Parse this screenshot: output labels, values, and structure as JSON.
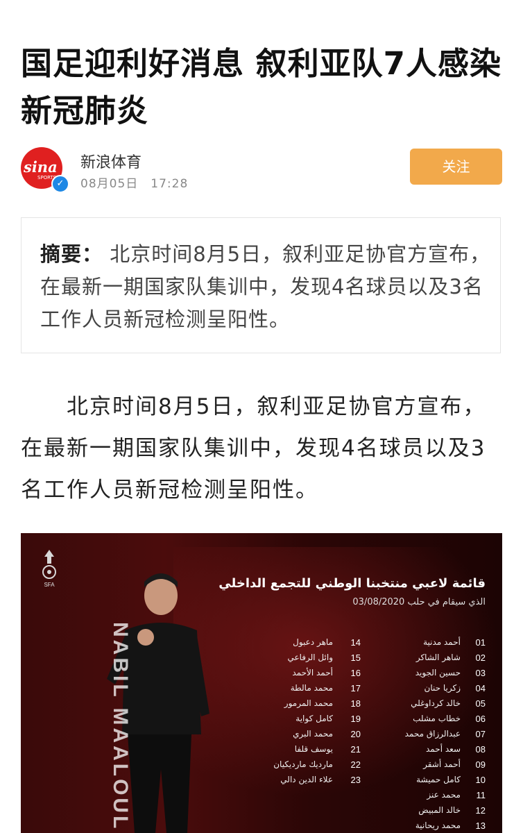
{
  "article": {
    "headline": "国足迎利好消息 叙利亚队7人感染新冠肺炎",
    "author": {
      "name": "新浪体育",
      "avatar_text": "sina",
      "avatar_sub": "SPORTS",
      "time": "08月05日　17:28"
    },
    "follow_label": "关注",
    "summary_label": "摘要：",
    "summary_text": "北京时间8月5日，叙利亚足协官方宣布，在最新一期国家队集训中，发现4名球员以及3名工作人员新冠检测呈阳性。",
    "body": "北京时间8月5日，叙利亚足协官方宣布，在最新一期国家队集训中，发现4名球员以及3名工作人员新冠检测呈阳性。"
  },
  "photo": {
    "emblem_text": "SFA",
    "vertical_name": "NABIL MAALOUL",
    "title_ar": "قائمة لاعبي منتخبنا الوطني للتجمع الداخلي",
    "subtitle_ar": "الذي سيقام في حلب 03/08/2020",
    "players_left": [
      {
        "num": "01",
        "name": "أحمد مدنية"
      },
      {
        "num": "02",
        "name": "شاهر الشاكر"
      },
      {
        "num": "03",
        "name": "حسين الجويد"
      },
      {
        "num": "04",
        "name": "زكريا حنان"
      },
      {
        "num": "05",
        "name": "خالد كرداوغلي"
      },
      {
        "num": "06",
        "name": "خطاب مشلب"
      },
      {
        "num": "07",
        "name": "عبدالرزاق محمد"
      },
      {
        "num": "08",
        "name": "سعد أحمد"
      },
      {
        "num": "09",
        "name": "أحمد أشقر"
      },
      {
        "num": "10",
        "name": "كامل حميشة"
      },
      {
        "num": "11",
        "name": "محمد عنز"
      },
      {
        "num": "12",
        "name": "خالد المبيض"
      },
      {
        "num": "13",
        "name": "محمد ريحانية"
      }
    ],
    "players_right": [
      {
        "num": "14",
        "name": "ماهر دعبول"
      },
      {
        "num": "15",
        "name": "وائل الرفاعي"
      },
      {
        "num": "16",
        "name": "أحمد الأحمد"
      },
      {
        "num": "17",
        "name": "محمد مالطة"
      },
      {
        "num": "18",
        "name": "محمد المرمور"
      },
      {
        "num": "19",
        "name": "كامل كواية"
      },
      {
        "num": "20",
        "name": "محمد البري"
      },
      {
        "num": "21",
        "name": "يوسف قلفا"
      },
      {
        "num": "22",
        "name": "ماردیك ماردیكيان"
      },
      {
        "num": "23",
        "name": "علاء الدين دالي"
      }
    ]
  },
  "colors": {
    "follow_button": "#f2a94b",
    "sina_red": "#e02020",
    "verified_blue": "#1e88e5",
    "photo_background": "#3a0a0a"
  }
}
